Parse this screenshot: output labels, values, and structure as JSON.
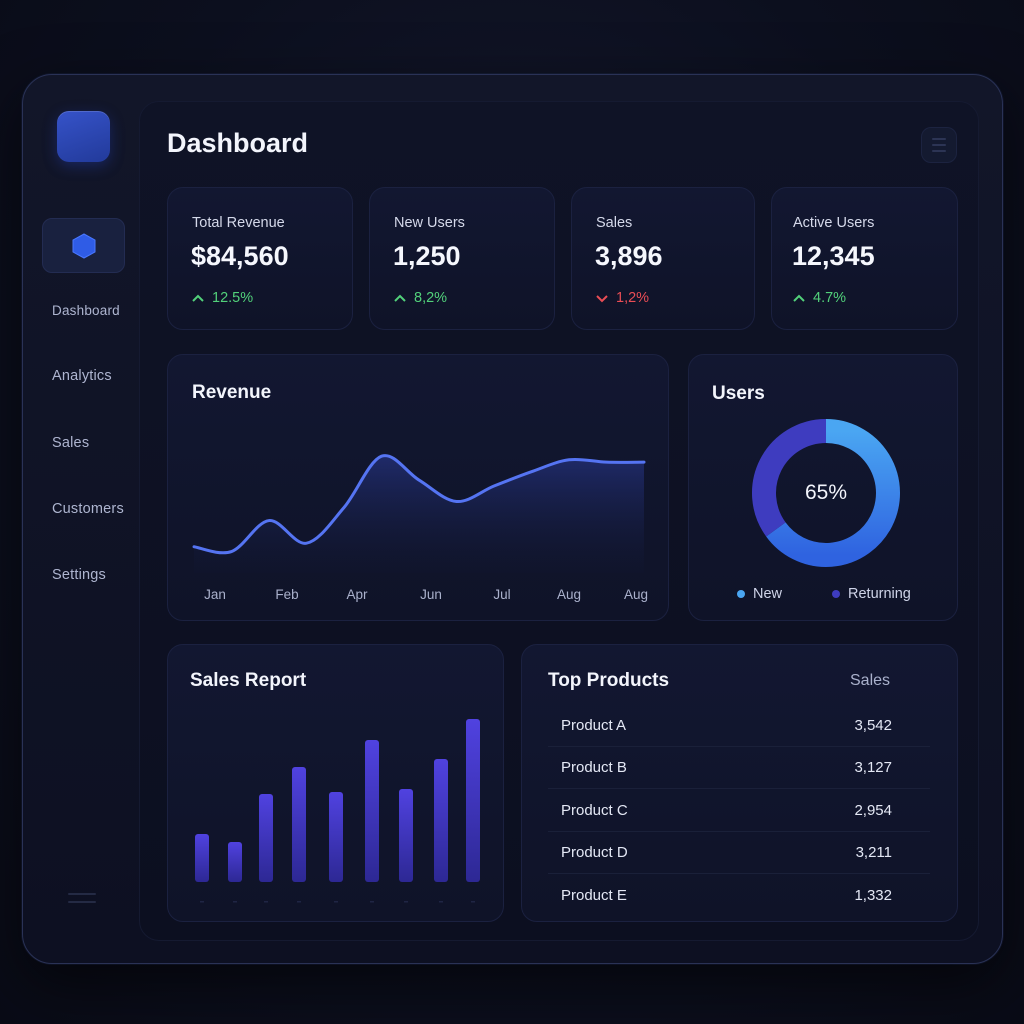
{
  "page": {
    "title": "Dashboard"
  },
  "sidebar": {
    "items": [
      {
        "label": "Dashboard"
      },
      {
        "label": "Analytics"
      },
      {
        "label": "Sales"
      },
      {
        "label": "Customers"
      },
      {
        "label": "Settings"
      }
    ]
  },
  "kpis": [
    {
      "label": "Total Revenue",
      "value": "$84,560",
      "delta": "12.5%",
      "trend": "up"
    },
    {
      "label": "New Users",
      "value": "1,250",
      "delta": "8,2%",
      "trend": "up"
    },
    {
      "label": "Sales",
      "value": "3,896",
      "delta": "1,2%",
      "trend": "down"
    },
    {
      "label": "Active Users",
      "value": "12,345",
      "delta": "4.7%",
      "trend": "up"
    }
  ],
  "colors": {
    "accent": "#4a6ff0",
    "up": "#52d17a",
    "down": "#ea4d55",
    "bar": "#4a3fd6",
    "donut_new": "#3d8ff0",
    "donut_returning": "#3e3cbf"
  },
  "revenue": {
    "title": "Revenue"
  },
  "users": {
    "title": "Users",
    "center_label": "65%",
    "legend_new": "New",
    "legend_returning": "Returning"
  },
  "sales_report": {
    "title": "Sales Report"
  },
  "top_products": {
    "title": "Top Products",
    "column_header": "Sales",
    "rows": [
      {
        "name": "Product A",
        "sales": "3,542"
      },
      {
        "name": "Product B",
        "sales": "3,127"
      },
      {
        "name": "Product C",
        "sales": "2,954"
      },
      {
        "name": "Product D",
        "sales": "3,211"
      },
      {
        "name": "Product E",
        "sales": "1,332"
      }
    ]
  },
  "chart_data": [
    {
      "type": "area",
      "title": "Revenue",
      "categories": [
        "Jan",
        "Feb",
        "Apr",
        "Jun",
        "Jul",
        "Aug",
        "Aug"
      ],
      "x": [
        0,
        0.5,
        1,
        1.5,
        2,
        2.5,
        3,
        3.5,
        4,
        4.5,
        5,
        5.5,
        6
      ],
      "values": [
        22,
        18,
        44,
        25,
        55,
        98,
        78,
        60,
        73,
        85,
        95,
        93,
        93
      ],
      "ylim": [
        0,
        120
      ],
      "grid": false
    },
    {
      "type": "pie",
      "title": "Users",
      "labels": [
        "New",
        "Returning"
      ],
      "values": [
        65,
        35
      ]
    },
    {
      "type": "bar",
      "title": "Sales Report",
      "values": [
        48,
        40,
        88,
        115,
        90,
        142,
        93,
        123,
        163
      ],
      "ylim": [
        0,
        180
      ]
    }
  ]
}
